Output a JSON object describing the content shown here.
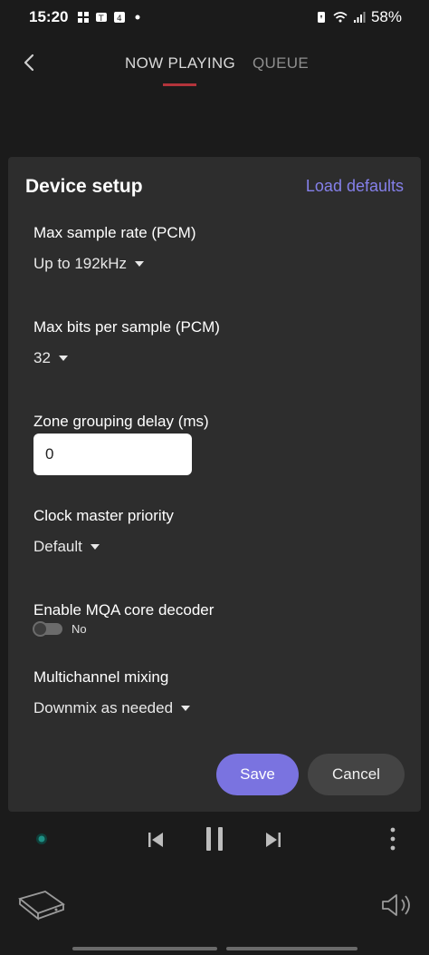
{
  "status_bar": {
    "time": "15:20",
    "battery": "58%",
    "left_icons": [
      "grid-icon",
      "teams-icon",
      "notification-4-icon",
      "dot-icon"
    ],
    "right_icons": [
      "battery-saver-icon",
      "wifi-icon",
      "signal-icon"
    ]
  },
  "nav": {
    "tabs": [
      {
        "label": "NOW PLAYING",
        "active": true
      },
      {
        "label": "QUEUE",
        "active": false
      }
    ],
    "accent_color": "#b3343b"
  },
  "dialog": {
    "title": "Device setup",
    "load_defaults": "Load defaults",
    "settings": {
      "sample_rate": {
        "label": "Max sample rate (PCM)",
        "value": "Up to 192kHz"
      },
      "bits": {
        "label": "Max bits per sample (PCM)",
        "value": "32"
      },
      "zone_delay": {
        "label": "Zone grouping delay (ms)",
        "value": "0"
      },
      "clock": {
        "label": "Clock master priority",
        "value": "Default"
      },
      "mqa": {
        "label": "Enable MQA core decoder",
        "toggle_text": "No",
        "enabled": false
      },
      "multichannel": {
        "label": "Multichannel mixing",
        "value": "Downmix as needed"
      }
    },
    "save": "Save",
    "cancel": "Cancel",
    "primary_color": "#7a73e0"
  },
  "player": {
    "controls": [
      "previous-icon",
      "pause-icon",
      "next-icon",
      "more-icon"
    ]
  }
}
